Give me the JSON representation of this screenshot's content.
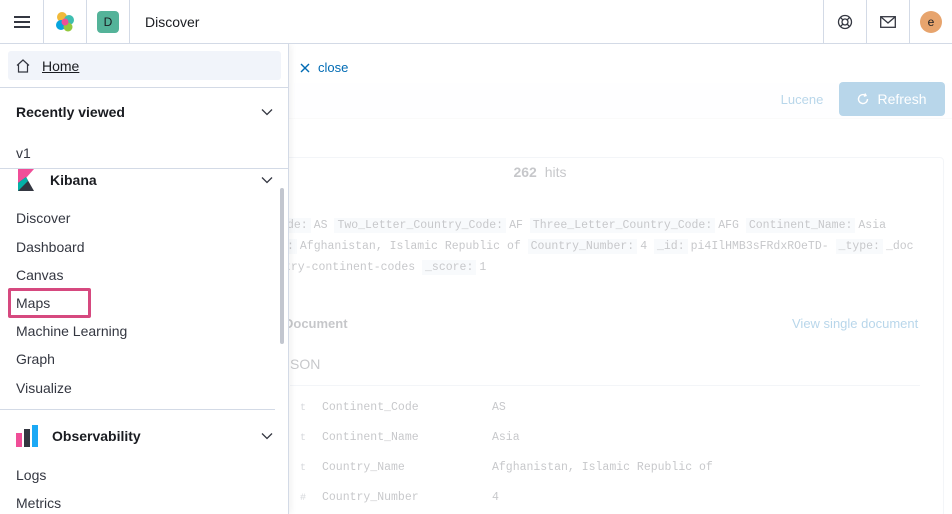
{
  "header": {
    "app_title": "Discover",
    "space_initial": "D",
    "user_initial": "e",
    "icons": [
      "menu-icon",
      "elastic-logo-icon",
      "help-icon",
      "mail-icon"
    ]
  },
  "nav": {
    "home": "Home",
    "recently_viewed": {
      "title": "Recently viewed",
      "items": [
        "v1"
      ]
    },
    "kibana": {
      "title": "Kibana",
      "items": [
        "Discover",
        "Dashboard",
        "Canvas",
        "Maps",
        "Machine Learning",
        "Graph",
        "Visualize"
      ]
    },
    "observability": {
      "title": "Observability",
      "items": [
        "Logs",
        "Metrics"
      ]
    },
    "highlighted_item": "Maps",
    "highlight_color": "#d6497f"
  },
  "discover": {
    "close_label": "close",
    "lucene_label": "Lucene",
    "refresh_label": "Refresh",
    "hits_count": "262",
    "hits_label": "hits",
    "doc_line1": [
      {
        "k": "de:",
        "v": "AS"
      },
      {
        "k": "Two_Letter_Country_Code:",
        "v": "AF"
      },
      {
        "k": "Three_Letter_Country_Code:",
        "v": "AFG"
      },
      {
        "k": "Continent_Name:",
        "v": "Asia"
      }
    ],
    "doc_line2": [
      {
        "k": ":",
        "v": "Afghanistan, Islamic Republic of"
      },
      {
        "k": "Country_Number:",
        "v": "4"
      },
      {
        "k": "_id:",
        "v": "pi4IlHMB3sFRdxROeTD-"
      },
      {
        "k": "_type:",
        "v": "_doc"
      }
    ],
    "doc_line3": [
      {
        "k": "",
        "v": "try-continent-codes"
      },
      {
        "k": "_score:",
        "v": "1"
      }
    ],
    "expanded_title": "Document",
    "view_single": "View single document",
    "json_tab": "SON",
    "fields": [
      {
        "type": "t",
        "name": "Continent_Code",
        "value": "AS"
      },
      {
        "type": "t",
        "name": "Continent_Name",
        "value": "Asia"
      },
      {
        "type": "t",
        "name": "Country_Name",
        "value": "Afghanistan, Islamic Republic of"
      },
      {
        "type": "#",
        "name": "Country_Number",
        "value": "4"
      }
    ]
  }
}
